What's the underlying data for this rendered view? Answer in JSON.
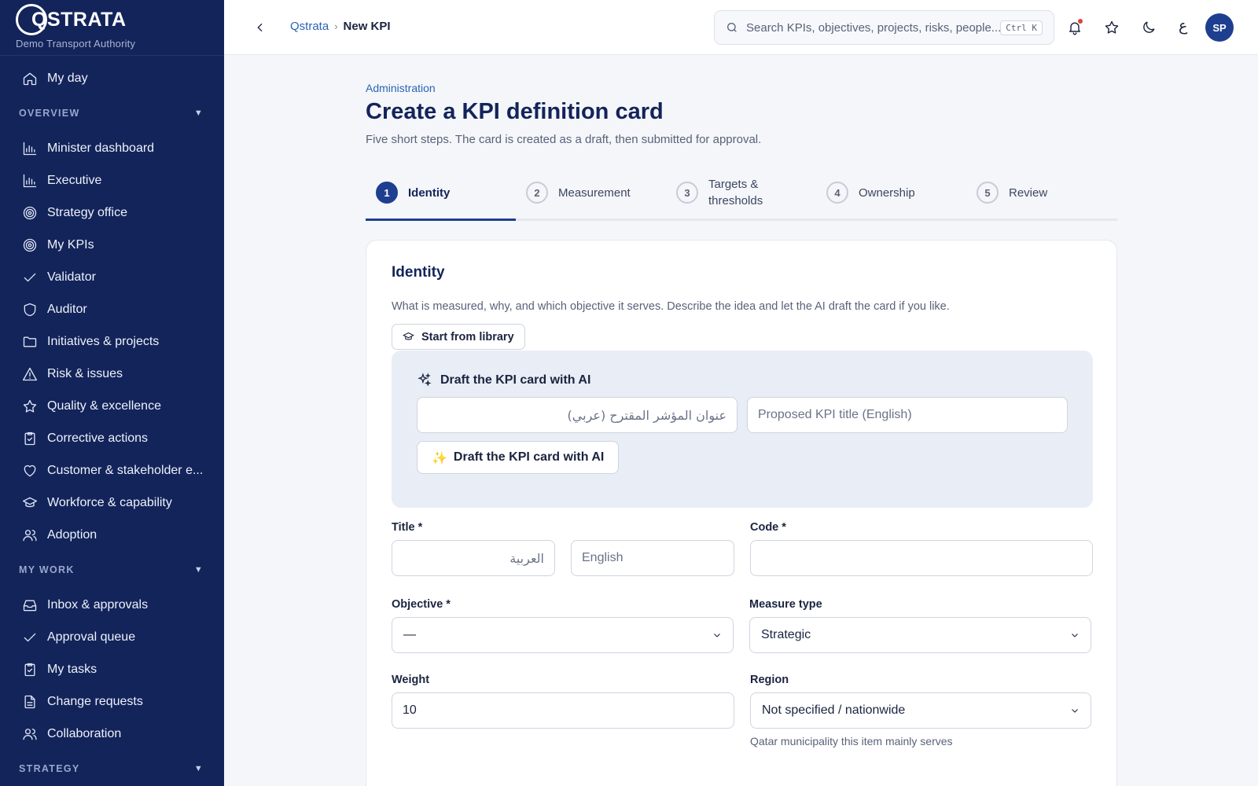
{
  "brand": {
    "logo_text": "QSTRATA",
    "org": "Demo Transport Authority"
  },
  "sidebar": {
    "top_items": [
      {
        "label": "My day",
        "icon": "home-icon"
      }
    ],
    "overview": {
      "heading": "OVERVIEW",
      "items": [
        {
          "label": "Minister dashboard",
          "icon": "bar-chart-icon"
        },
        {
          "label": "Executive",
          "icon": "bar-chart-icon"
        },
        {
          "label": "Strategy office",
          "icon": "target-icon"
        },
        {
          "label": "My KPIs",
          "icon": "target-icon"
        },
        {
          "label": "Validator",
          "icon": "check-icon"
        },
        {
          "label": "Auditor",
          "icon": "shield-icon"
        },
        {
          "label": "Initiatives & projects",
          "icon": "folder-icon"
        },
        {
          "label": "Risk & issues",
          "icon": "warning-icon"
        },
        {
          "label": "Quality & excellence",
          "icon": "star-icon"
        },
        {
          "label": "Corrective actions",
          "icon": "clipboard-check-icon"
        },
        {
          "label": "Customer & stakeholder e...",
          "icon": "heart-icon"
        },
        {
          "label": "Workforce & capability",
          "icon": "graduation-cap-icon"
        },
        {
          "label": "Adoption",
          "icon": "users-icon"
        }
      ]
    },
    "my_work": {
      "heading": "MY WORK",
      "items": [
        {
          "label": "Inbox & approvals",
          "icon": "inbox-icon"
        },
        {
          "label": "Approval queue",
          "icon": "check-icon"
        },
        {
          "label": "My tasks",
          "icon": "clipboard-check-icon"
        },
        {
          "label": "Change requests",
          "icon": "document-icon"
        },
        {
          "label": "Collaboration",
          "icon": "users-icon"
        }
      ]
    },
    "strategy": {
      "heading": "STRATEGY"
    }
  },
  "topbar": {
    "breadcrumb_root": "Qstrata",
    "breadcrumb_sep": "›",
    "breadcrumb_current": "New KPI",
    "search_placeholder": "Search KPIs, objectives, projects, risks, people...",
    "search_shortcut": "Ctrl K",
    "language_toggle": "ع",
    "avatar_initials": "SP",
    "notification_dot_color": "#e04040"
  },
  "page": {
    "eyebrow": "Administration",
    "title": "Create a KPI definition card",
    "subtitle": "Five short steps. The card is created as a draft, then submitted for approval."
  },
  "steps": [
    {
      "num": "1",
      "label": "Identity",
      "active": true
    },
    {
      "num": "2",
      "label": "Measurement",
      "active": false
    },
    {
      "num": "3",
      "label": "Targets & thresholds",
      "active": false
    },
    {
      "num": "4",
      "label": "Ownership",
      "active": false
    },
    {
      "num": "5",
      "label": "Review",
      "active": false
    }
  ],
  "identity": {
    "heading": "Identity",
    "description": "What is measured, why, and which objective it serves. Describe the idea and let the AI draft the card if you like.",
    "library_button": "Start from library",
    "ai": {
      "heading": "Draft the KPI card with AI",
      "title_ar_placeholder": "عنوان المؤشر المقترح (عربي)",
      "title_en_placeholder": "Proposed KPI title (English)",
      "button_label": "Draft the KPI card with AI",
      "button_glyph": "✨"
    },
    "fields": {
      "title_label": "Title *",
      "title_ar_placeholder": "العربية",
      "title_en_placeholder": "English",
      "code_label": "Code *",
      "code_value": "",
      "objective_label": "Objective *",
      "objective_value": "—",
      "measure_type_label": "Measure type",
      "measure_type_value": "Strategic",
      "weight_label": "Weight",
      "weight_value": "10",
      "region_label": "Region",
      "region_value": "Not specified / nationwide",
      "region_helper": "Qatar municipality this item mainly serves"
    }
  },
  "colors": {
    "sidebar_bg": "#13245a",
    "accent": "#1e3f8f",
    "link": "#2a64b4",
    "ai_panel_bg": "#e9edf5"
  }
}
